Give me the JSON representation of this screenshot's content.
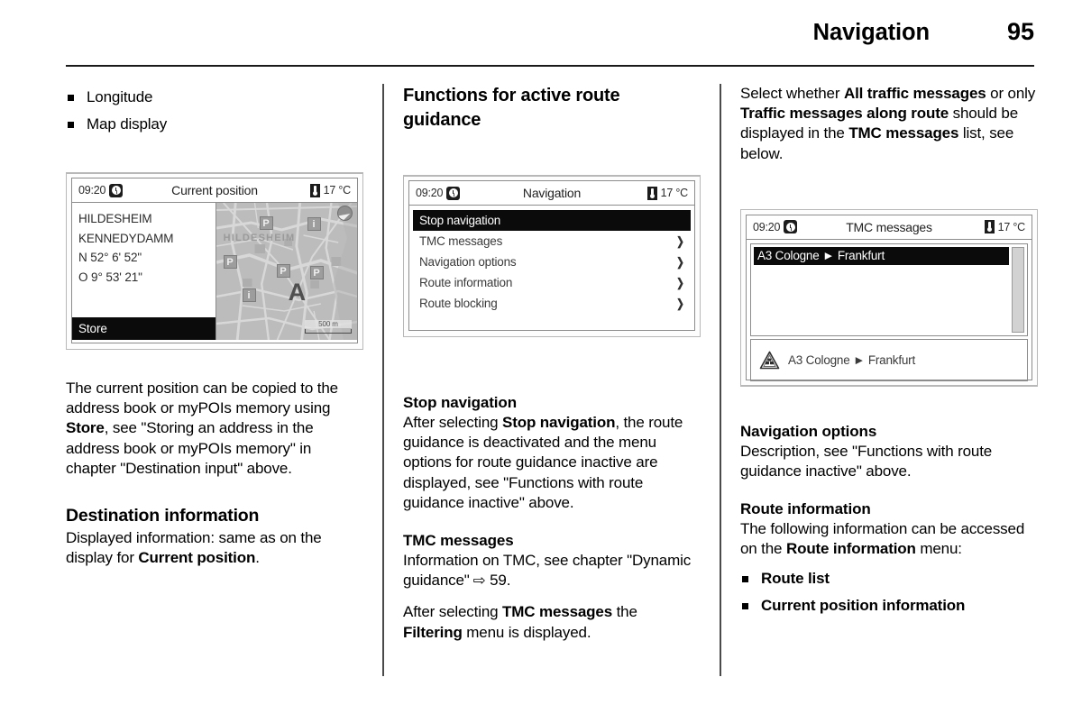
{
  "header": {
    "title": "Navigation",
    "page_number": "95"
  },
  "column1": {
    "bullets": [
      "Longitude",
      "Map display"
    ],
    "display": {
      "status": {
        "clock": "09:20",
        "title": "Current position",
        "temperature": "17 °C"
      },
      "address_lines": [
        "HILDESHEIM",
        "KENNEDYDAMM",
        "N 52° 6' 52\"",
        "O 9° 53' 21\""
      ],
      "store_button": "Store",
      "map": {
        "city_label": "HILDESHEIM",
        "scale": "500 m",
        "car_marker": "A",
        "poi_parking": "P",
        "poi_info": "i"
      }
    },
    "paragraph_1_a": "The current position can be copied to the address book or myPOIs memory using ",
    "paragraph_1_b": "Store",
    "paragraph_1_c": ", see \"Storing an address in the address book or myPOIs memory\" in chapter \"Destination input\" above.",
    "heading_destination": "Destination information",
    "paragraph_2_a": "Displayed information: same as on the display for ",
    "paragraph_2_b": "Current position",
    "paragraph_2_c": "."
  },
  "column2": {
    "heading": "Functions for active route guidance",
    "display": {
      "status": {
        "clock": "09:20",
        "title": "Navigation",
        "temperature": "17 °C"
      },
      "menu_items": [
        {
          "label": "Stop navigation",
          "selected": true,
          "submenu": false
        },
        {
          "label": "TMC messages",
          "selected": false,
          "submenu": true
        },
        {
          "label": "Navigation options",
          "selected": false,
          "submenu": true
        },
        {
          "label": "Route information",
          "selected": false,
          "submenu": true
        },
        {
          "label": "Route blocking",
          "selected": false,
          "submenu": true
        }
      ],
      "submenu_glyph": "❯"
    },
    "heading_stop": "Stop navigation",
    "stop_a": "After selecting ",
    "stop_b": "Stop navigation",
    "stop_c": ", the route guidance is deactivated and the menu options for route guidance inactive are displayed, see \"Functions with route guidance inactive\" above.",
    "heading_tmc": "TMC messages",
    "tmc_a": "Information on TMC, see chapter \"Dynamic guidance\" ",
    "tmc_arrow": "⇨",
    "tmc_b": " 59.",
    "tmc_c": "After selecting ",
    "tmc_d": "TMC messages",
    "tmc_e": " the ",
    "tmc_f": "Filtering",
    "tmc_g": " menu is displayed."
  },
  "column3": {
    "intro_a": "Select whether ",
    "intro_b": "All traffic messages",
    "intro_c": " or only ",
    "intro_d": "Traffic messages along route",
    "intro_e": " should be displayed in the ",
    "intro_f": "TMC messages",
    "intro_g": " list, see below.",
    "display": {
      "status": {
        "clock": "09:20",
        "title": "TMC messages",
        "temperature": "17 °C"
      },
      "list_entry": "A3 Cologne ► Frankfurt",
      "detail_entry": "A3 Cologne ► Frankfurt"
    },
    "heading_navoptions": "Navigation options",
    "navoptions_text": "Description, see \"Functions with route guidance inactive\" above.",
    "heading_routeinfo": "Route information",
    "routeinfo_a": "The following information can be accessed on the ",
    "routeinfo_b": "Route information",
    "routeinfo_c": " menu:",
    "bullets": [
      "Route list",
      "Current position information"
    ]
  }
}
